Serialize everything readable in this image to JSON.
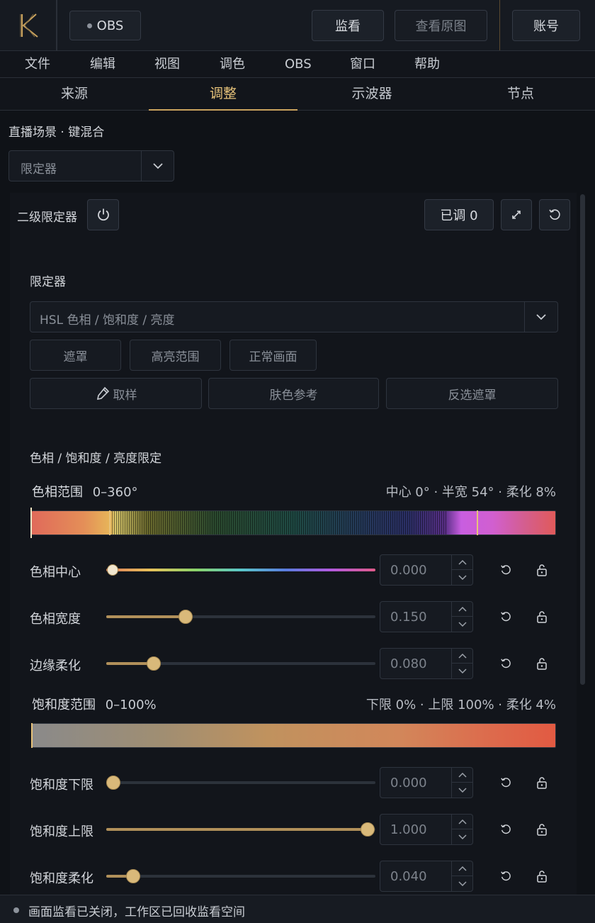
{
  "topbar": {
    "obs_button": "OBS",
    "monitor_button": "监看",
    "view_original_button": "查看原图",
    "account_button": "账号"
  },
  "menu": [
    "文件",
    "编辑",
    "视图",
    "调色",
    "OBS",
    "窗口",
    "帮助"
  ],
  "tabs": [
    "来源",
    "调整",
    "示波器",
    "节点"
  ],
  "active_tab": "调整",
  "breadcrumb": "直播场景 · 键混合",
  "tool_select": {
    "value": "限定器"
  },
  "panel": {
    "title": "二级限定器",
    "adjusted_badge": "已调 0"
  },
  "qualifier": {
    "label": "限定器",
    "mode_select": "HSL 色相 / 饱和度 / 亮度",
    "view_buttons": [
      "遮罩",
      "高亮范围",
      "正常画面"
    ],
    "action_buttons": [
      "取样",
      "肤色参考",
      "反选遮罩"
    ]
  },
  "hsl_section": {
    "title": "色相 / 饱和度 / 亮度限定",
    "hue_range": {
      "label": "色相范围",
      "range": "0–360°",
      "meta": "中心 0° · 半宽 54° · 柔化 8%"
    },
    "sat_range": {
      "label": "饱和度范围",
      "range": "0–100%",
      "meta": "下限 0% · 上限 100% · 柔化 4%"
    }
  },
  "params": [
    {
      "label": "色相中心",
      "value": "0.000",
      "level": 0.0,
      "style": "hue"
    },
    {
      "label": "色相宽度",
      "value": "0.150",
      "level": 0.3
    },
    {
      "label": "边缘柔化",
      "value": "0.080",
      "level": 0.18
    },
    {
      "label": "饱和度下限",
      "value": "0.000",
      "level": 0.0
    },
    {
      "label": "饱和度上限",
      "value": "1.000",
      "level": 1.0
    },
    {
      "label": "饱和度柔化",
      "value": "0.040",
      "level": 0.1
    }
  ],
  "status": {
    "text": "画面监看已关闭，工作区已回收监看空间"
  },
  "colors": {
    "accent": "#c9a25d",
    "background": "#0f1217"
  }
}
